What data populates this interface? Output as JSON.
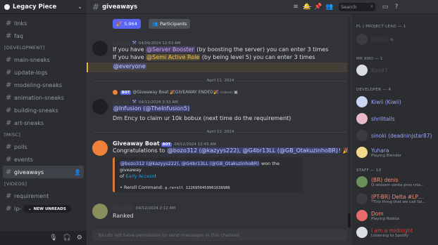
{
  "server": {
    "name": "Legacy Piece",
    "channels": [
      {
        "name": "links",
        "type": "channel"
      },
      {
        "name": "faq",
        "type": "channel"
      },
      {
        "name": "[DEVELOPMENT]",
        "type": "category"
      },
      {
        "name": "main-sneaks",
        "type": "channel"
      },
      {
        "name": "update-logs",
        "type": "channel"
      },
      {
        "name": "modeling-sneaks",
        "type": "channel"
      },
      {
        "name": "animation-sneaks",
        "type": "channel"
      },
      {
        "name": "building-sneaks",
        "type": "channel"
      },
      {
        "name": "art-sneaks",
        "type": "channel"
      },
      {
        "name": "[MISC]",
        "type": "category"
      },
      {
        "name": "polls",
        "type": "channel"
      },
      {
        "name": "events",
        "type": "channel"
      },
      {
        "name": "giveaways",
        "type": "channel",
        "active": true
      },
      {
        "name": "[VIDEOS]",
        "type": "category"
      },
      {
        "name": "requirement",
        "type": "channel"
      },
      {
        "name": "lp-",
        "type": "channel"
      }
    ],
    "new_unreads": "NEW UNREADS"
  },
  "topbar": {
    "channel_name": "giveaways",
    "search_placeholder": "Search"
  },
  "chat": {
    "top_buttons": {
      "count_label": "5,964",
      "participants_label": "Participants"
    },
    "msg1": {
      "timestamp": "04/09/2024 12:53 AM",
      "line1_pre": "If you have ",
      "line1_role": "@Server Booster",
      "line1_post": " (by boosting the server) you can enter 3 times",
      "line2_pre": "If you have ",
      "line2_role": "@Semi Active Role",
      "line2_post": " (by being level 5) you can enter 3 times",
      "line3": "@everyone"
    },
    "divider1": "April 11, 2024",
    "msg2": {
      "reply_bot": "BOT",
      "reply_text": "@Giveaway Boat 🎉GIVEAWAY ENDED🎉",
      "reply_edited": "(edited)",
      "timestamp": "04/11/2024 3:33 AM",
      "mention": "@Infusion (@TheInfusion5)",
      "body": "Dm Ency to claim ur 10k bobux (next time do the requirement)"
    },
    "divider2": "April 12, 2024",
    "msg3": {
      "author": "Giveaway Boat",
      "bot_tag": "BOT",
      "timestamp": "04/12/2024 12:43 AM",
      "body_pre": "Congratulations to ",
      "body_mentions": "@bozo312 (@kazyys222), @G4br13LL (@GB_OtakuzinhoBR)",
      "body_post": "! 🎉",
      "embed_mentions": "@bozo312 (@kazyys222), @G4br13LL (@GB_OtakuzinhoBR)",
      "embed_won": " won the giveaway",
      "embed_of": "of ",
      "embed_link": "Early Access",
      "embed_excl": "!",
      "reroll_label": "• Reroll Command: ",
      "reroll_code": "g.reroll 1226950459961638986"
    },
    "msg4": {
      "timestamp": "04/12/2024 2:12 AM",
      "body": "Ranked"
    },
    "input_placeholder": "You do not have permission to send messages in this channel."
  },
  "members": {
    "groups": [
      {
        "label": "PL | PROJECT LEAD — 1"
      },
      {
        "label": "MR KNO — 1"
      },
      {
        "label": "DEVELOPER — 4"
      },
      {
        "label": "STAFF — 10"
      }
    ],
    "dev_members": [
      {
        "name": "Kiwii (Kiwii)",
        "color": "#9aa4f8"
      },
      {
        "name": "shrilltails",
        "color": "#9aa4f8"
      },
      {
        "name": "sinoki (deadninjstar87)",
        "color": "#9aa4f8"
      },
      {
        "name": "Yuhara",
        "sub": "Playing Blender",
        "color": "#9aa4f8"
      }
    ],
    "staff_members": [
      {
        "name": "(BR) denis",
        "sub": "O-wissam venta pros cria…",
        "color": "#f28c7a"
      },
      {
        "name": "(PT-BR) Delta #LP…",
        "sub": "*This thing that we call fai…",
        "color": "#f28c7a"
      },
      {
        "name": "Dom",
        "sub": "Playing Roblox",
        "color": "#f28c7a"
      },
      {
        "name": "i am a midnight",
        "sub": "Listening to Spotify",
        "color": "#d83c3e"
      }
    ],
    "kno_member": "Kno97"
  },
  "colors": {
    "accent": "#5865f2",
    "bg": "#313338",
    "sidebar": "#2b2d31"
  }
}
